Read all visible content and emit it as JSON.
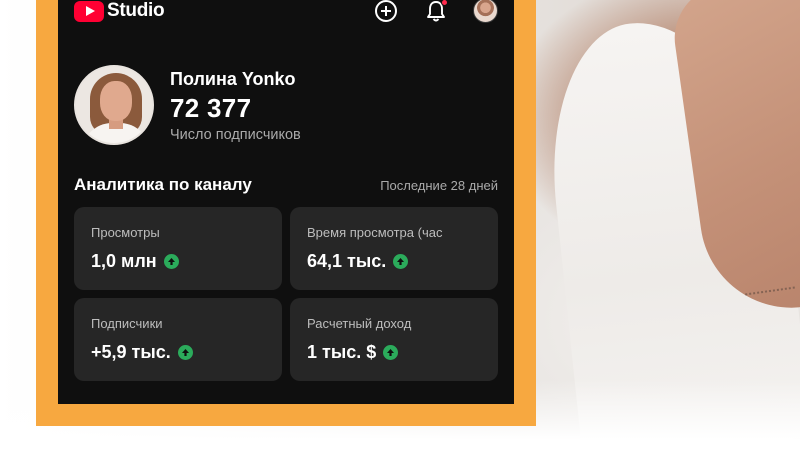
{
  "app": {
    "logo_text": "Studio",
    "brand_color": "#ff0033",
    "accent_frame": "#f7a840"
  },
  "topbar": {
    "icons": [
      "youtube-logo-icon",
      "add-icon",
      "bell-icon",
      "avatar"
    ]
  },
  "profile": {
    "channel_name": "Полина Yonko",
    "subscribers": "72 377",
    "subscribers_label": "Число подписчиков"
  },
  "analytics": {
    "title": "Аналитика по каналу",
    "period": "Последние 28 дней",
    "cards": [
      {
        "label": "Просмотры",
        "value": "1,0 млн",
        "trend": "up"
      },
      {
        "label": "Время просмотра (час",
        "value": "64,1 тыс.",
        "trend": "up"
      },
      {
        "label": "Подписчики",
        "value": "+5,9 тыс.",
        "trend": "up"
      },
      {
        "label": "Расчетный доход",
        "value": "1 тыс. $",
        "trend": "up"
      }
    ],
    "trend_color": "#2bab5b"
  }
}
